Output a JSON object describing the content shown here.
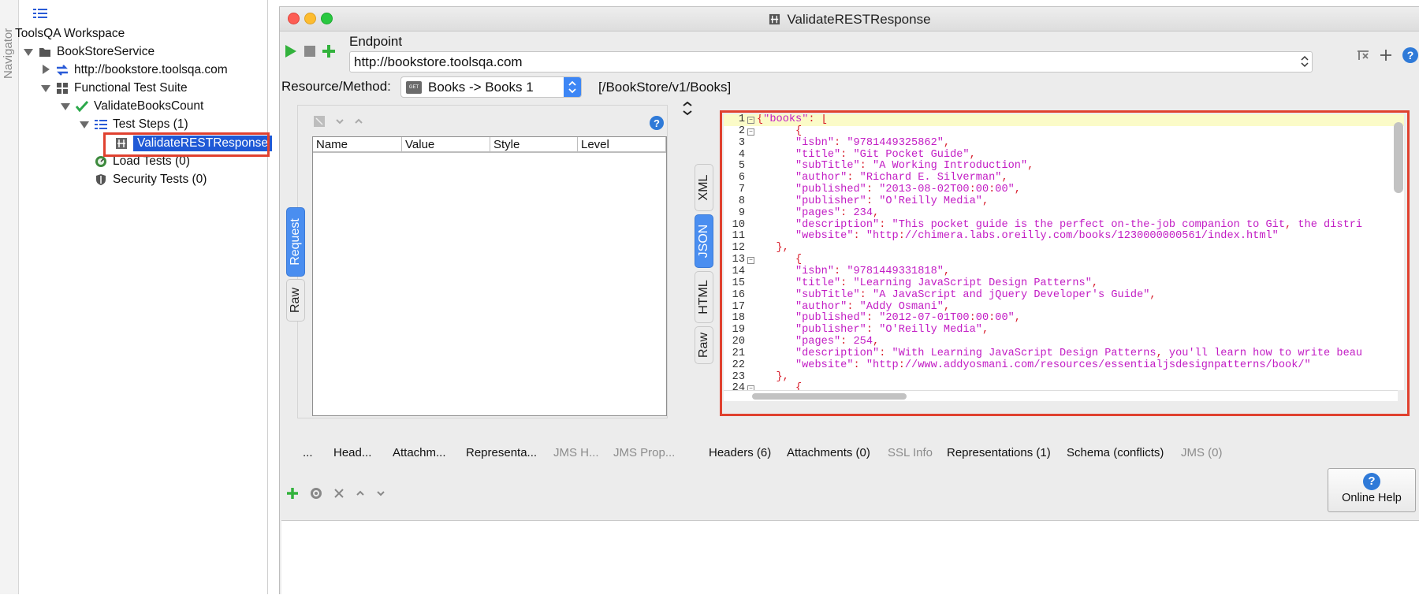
{
  "navigator": {
    "label": "Navigator"
  },
  "tree": {
    "workspace": "ToolsQA Workspace",
    "service": "BookStoreService",
    "endpoint": "http://bookstore.toolsqa.com",
    "suite": "Functional Test Suite",
    "testcase": "ValidateBooksCount",
    "steps": "Test Steps (1)",
    "step": "ValidateRESTResponse",
    "load": "Load Tests (0)",
    "security": "Security Tests (0)"
  },
  "window": {
    "title": "ValidateRESTResponse",
    "endpoint_label": "Endpoint",
    "endpoint_value": "http://bookstore.toolsqa.com",
    "resource_label": "Resource/Method:",
    "resource_value": "Books -> Books 1",
    "resource_badge": "GET",
    "resource_path": "[/BookStore/v1/Books]"
  },
  "request": {
    "columns": [
      "Name",
      "Value",
      "Style",
      "Level"
    ],
    "side_tabs": [
      "Request",
      "Raw"
    ]
  },
  "response": {
    "side_tabs": [
      "XML",
      "JSON",
      "HTML",
      "Raw"
    ],
    "lines": [
      {
        "n": "1",
        "t": "{\"books\": ["
      },
      {
        "n": "2",
        "t": "      {"
      },
      {
        "n": "3",
        "t": "      \"isbn\": \"9781449325862\","
      },
      {
        "n": "4",
        "t": "      \"title\": \"Git Pocket Guide\","
      },
      {
        "n": "5",
        "t": "      \"subTitle\": \"A Working Introduction\","
      },
      {
        "n": "6",
        "t": "      \"author\": \"Richard E. Silverman\","
      },
      {
        "n": "7",
        "t": "      \"published\": \"2013-08-02T00:00:00\","
      },
      {
        "n": "8",
        "t": "      \"publisher\": \"O'Reilly Media\","
      },
      {
        "n": "9",
        "t": "      \"pages\": 234,"
      },
      {
        "n": "10",
        "t": "      \"description\": \"This pocket guide is the perfect on-the-job companion to Git, the distri"
      },
      {
        "n": "11",
        "t": "      \"website\": \"http://chimera.labs.oreilly.com/books/1230000000561/index.html\""
      },
      {
        "n": "12",
        "t": "   },"
      },
      {
        "n": "13",
        "t": "      {"
      },
      {
        "n": "14",
        "t": "      \"isbn\": \"9781449331818\","
      },
      {
        "n": "15",
        "t": "      \"title\": \"Learning JavaScript Design Patterns\","
      },
      {
        "n": "16",
        "t": "      \"subTitle\": \"A JavaScript and jQuery Developer's Guide\","
      },
      {
        "n": "17",
        "t": "      \"author\": \"Addy Osmani\","
      },
      {
        "n": "18",
        "t": "      \"published\": \"2012-07-01T00:00:00\","
      },
      {
        "n": "19",
        "t": "      \"publisher\": \"O'Reilly Media\","
      },
      {
        "n": "20",
        "t": "      \"pages\": 254,"
      },
      {
        "n": "21",
        "t": "      \"description\": \"With Learning JavaScript Design Patterns, you'll learn how to write beau"
      },
      {
        "n": "22",
        "t": "      \"website\": \"http://www.addyosmani.com/resources/essentialjsdesignpatterns/book/\""
      },
      {
        "n": "23",
        "t": "   },"
      },
      {
        "n": "24",
        "t": "      {"
      }
    ]
  },
  "bottom_tabs_left": [
    "...",
    "Head...",
    "Attachm...",
    "Representa...",
    "JMS H...",
    "JMS Prop..."
  ],
  "bottom_tabs_right": [
    "Headers (6)",
    "Attachments (0)",
    "SSL Info",
    "Representations (1)",
    "Schema (conflicts)",
    "JMS (0)"
  ],
  "online_help": "Online Help",
  "colors": {
    "selection": "#1f59d6",
    "highlight": "#e0412f",
    "json_key": "#c21cc4",
    "json_punct": "#d81d2b",
    "active_tab": "#4a8ef0"
  }
}
